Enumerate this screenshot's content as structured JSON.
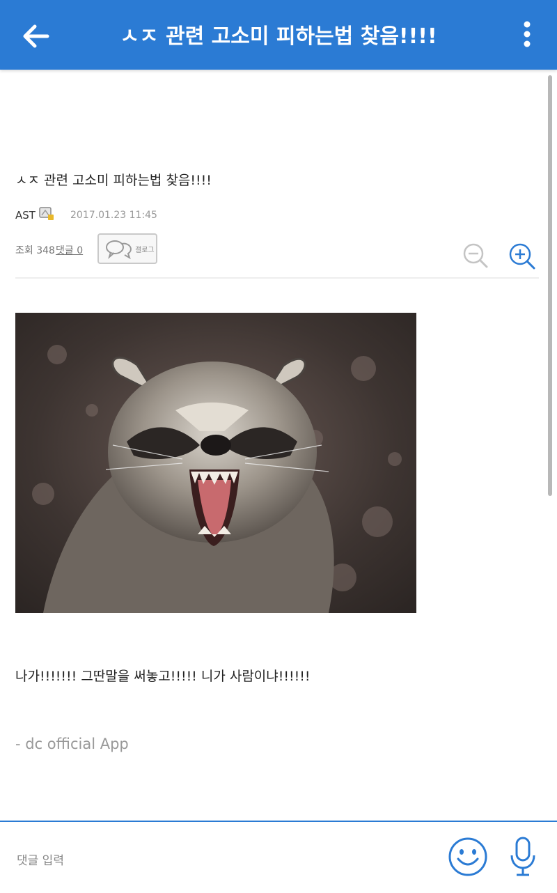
{
  "header": {
    "title": "ㅅㅈ 관련 고소미 피하는법 찾음!!!!",
    "back_icon": "arrow-left-icon",
    "menu_icon": "more-vertical-icon",
    "color": "#2b7bd4"
  },
  "post": {
    "title": "ㅅㅈ 관련 고소미 피하는법 찾음!!!!",
    "author": "AST",
    "author_badge_icon": "fixed-nick-badge-icon",
    "date": "2017.01.23 11:45",
    "views_text": "조회 348",
    "comments_text": "댓글 0",
    "gallog_label": "갤로그",
    "zoom_out_icon": "zoom-out-icon",
    "zoom_in_icon": "zoom-in-icon",
    "image": "photo-of-snarling-raccoon",
    "body": "나가!!!!!!! 그딴말을 써놓고!!!!! 니가 사람이냐!!!!!!",
    "signature": "- dc official App"
  },
  "comment_bar": {
    "placeholder": "댓글 입력",
    "emoji_icon": "smiley-face-icon",
    "mic_icon": "microphone-icon"
  }
}
